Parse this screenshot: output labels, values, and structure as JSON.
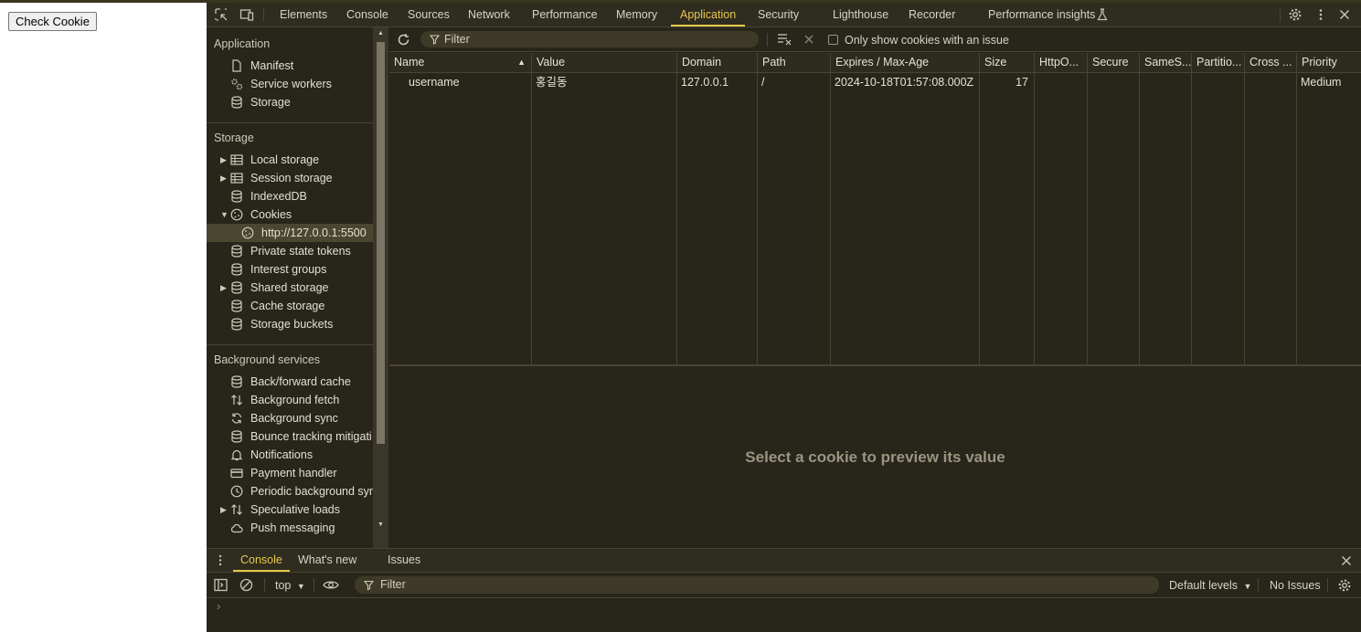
{
  "page": {
    "check_button": "Check Cookie"
  },
  "devtools": {
    "tabs": [
      "Elements",
      "Console",
      "Sources",
      "Network",
      "Performance",
      "Memory",
      "Application",
      "Security",
      "Lighthouse",
      "Recorder",
      "Performance insights"
    ],
    "active_tab": "Application",
    "sidebar": {
      "application_title": "Application",
      "application_items": [
        "Manifest",
        "Service workers",
        "Storage"
      ],
      "storage_title": "Storage",
      "storage_items": [
        "Local storage",
        "Session storage",
        "IndexedDB",
        "Cookies",
        "http://127.0.0.1:5500",
        "Private state tokens",
        "Interest groups",
        "Shared storage",
        "Cache storage",
        "Storage buckets"
      ],
      "background_title": "Background services",
      "background_items": [
        "Back/forward cache",
        "Background fetch",
        "Background sync",
        "Bounce tracking mitigati",
        "Notifications",
        "Payment handler",
        "Periodic background syn",
        "Speculative loads",
        "Push messaging"
      ]
    },
    "cookies_toolbar": {
      "filter_placeholder": "Filter",
      "only_issue_label": "Only show cookies with an issue"
    },
    "table": {
      "columns": [
        "Name",
        "Value",
        "Domain",
        "Path",
        "Expires / Max-Age",
        "Size",
        "HttpO...",
        "Secure",
        "SameS...",
        "Partitio...",
        "Cross ...",
        "Priority"
      ],
      "rows": [
        [
          "username",
          "홍길동",
          "127.0.0.1",
          "/",
          "2024-10-18T01:57:08.000Z",
          "17",
          "",
          "",
          "",
          "",
          "",
          "Medium"
        ]
      ]
    },
    "preview_text": "Select a cookie to preview its value",
    "drawer": {
      "tabs": [
        "Console",
        "What's new",
        "Issues"
      ],
      "active_tab": "Console",
      "context": "top",
      "filter_placeholder": "Filter",
      "levels": "Default levels",
      "issues": "No Issues",
      "prompt": "›"
    },
    "colors": {
      "accent": "#e8c84a",
      "background": "#28251b"
    }
  }
}
